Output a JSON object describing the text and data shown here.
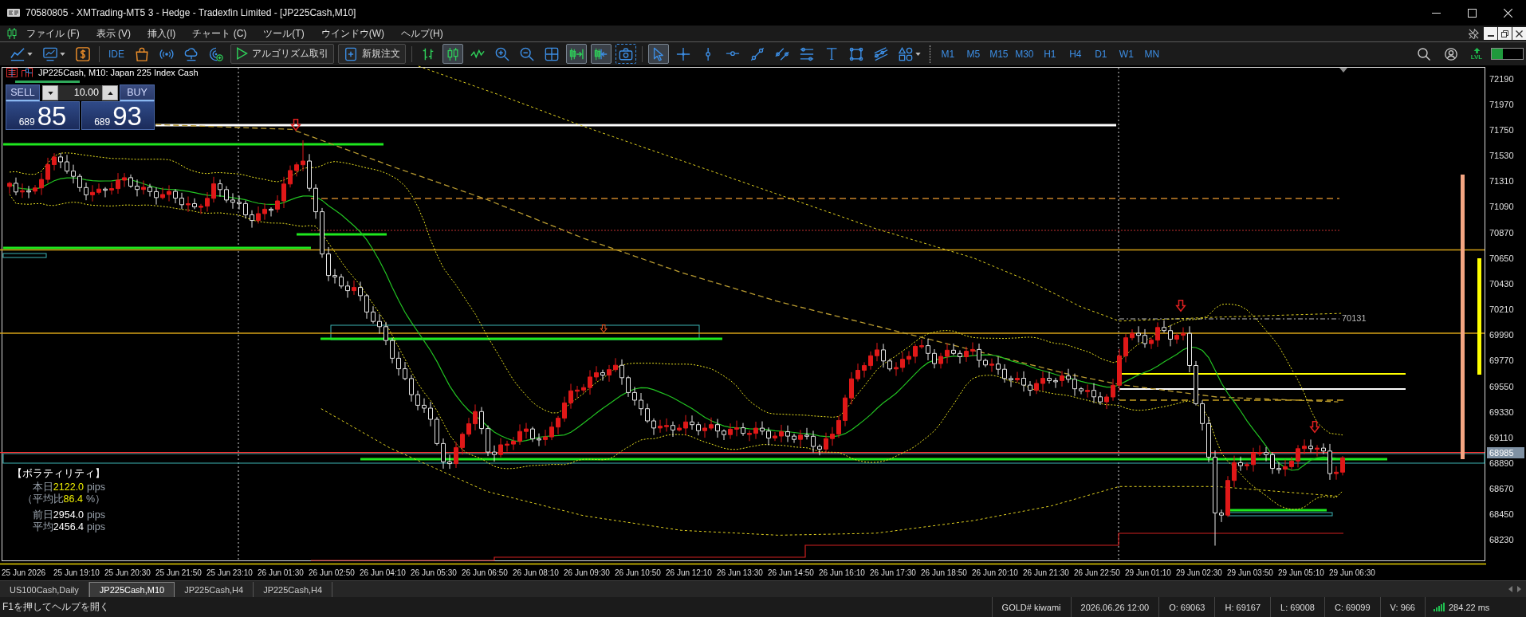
{
  "window": {
    "title": "70580805 - XMTrading-MT5 3 - Hedge - Tradexfin Limited - [JP225Cash,M10]"
  },
  "menu": {
    "items": [
      "ファイル (F)",
      "表示 (V)",
      "挿入(I)",
      "チャート (C)",
      "ツール(T)",
      "ウインドウ(W)",
      "ヘルプ(H)"
    ]
  },
  "toolbar": {
    "groups": [
      [
        {
          "kind": "chart_type",
          "selected": false
        },
        {
          "kind": "template",
          "selected": false
        },
        {
          "kind": "dollar",
          "selected": false
        }
      ],
      [
        {
          "kind": "ide",
          "label": "IDE",
          "selected": false
        },
        {
          "kind": "market",
          "selected": false
        },
        {
          "kind": "signals",
          "selected": false
        },
        {
          "kind": "cloud",
          "selected": false
        },
        {
          "kind": "vps",
          "selected": false
        },
        {
          "kind": "algo",
          "label": "アルゴリズム取引",
          "selected": false
        },
        {
          "kind": "new_order",
          "label": "新規注文",
          "selected": false
        }
      ],
      [
        {
          "kind": "bars",
          "selected": false
        },
        {
          "kind": "candles",
          "selected": true
        },
        {
          "kind": "line",
          "selected": false
        },
        {
          "kind": "zoom_in",
          "selected": false
        },
        {
          "kind": "zoom_out",
          "selected": false
        },
        {
          "kind": "grid",
          "selected": false
        },
        {
          "kind": "autoscroll",
          "selected": true
        },
        {
          "kind": "shift",
          "selected": true
        },
        {
          "kind": "screenshot",
          "selected": false
        }
      ],
      [
        {
          "kind": "cursor",
          "selected": true
        },
        {
          "kind": "crosshair",
          "selected": false
        },
        {
          "kind": "vline",
          "selected": false
        },
        {
          "kind": "hline",
          "selected": false
        },
        {
          "kind": "trendline",
          "selected": false
        },
        {
          "kind": "channel",
          "selected": false
        },
        {
          "kind": "fibo",
          "selected": false
        },
        {
          "kind": "text",
          "selected": false
        },
        {
          "kind": "rectangle",
          "selected": false
        },
        {
          "kind": "pitchfork",
          "selected": false
        },
        {
          "kind": "shapes",
          "selected": false
        }
      ]
    ],
    "timeframes": [
      {
        "label": "M1",
        "selected": false
      },
      {
        "label": "M5",
        "selected": false
      },
      {
        "label": "M15",
        "selected": false
      },
      {
        "label": "M30",
        "selected": false
      },
      {
        "label": "H1",
        "selected": false
      },
      {
        "label": "H4",
        "selected": false
      },
      {
        "label": "D1",
        "selected": false
      },
      {
        "label": "W1",
        "selected": false
      },
      {
        "label": "MN",
        "selected": false
      }
    ],
    "level_label": "LVL",
    "meter": {
      "level": 0.35
    }
  },
  "trade_panel": {
    "title": "JP225Cash, M10: Japan 225 Index Cash",
    "sell_label": "SELL",
    "buy_label": "BUY",
    "volume": "10.00",
    "sell_price": {
      "prefix": "689",
      "main": "85"
    },
    "buy_price": {
      "prefix": "689",
      "main": "93"
    }
  },
  "chart": {
    "line_label": "70131"
  },
  "volatility": {
    "title": "【ボラティリティ】",
    "rows": [
      {
        "label": "本日",
        "value": "2122.0",
        "unit": "pips",
        "color": "#f0f000"
      },
      {
        "label": "（平均比",
        "value": "86.4",
        "unit": "%）",
        "color": "#f0f000"
      },
      {
        "label": "前日",
        "value": "2954.0",
        "unit": "pips",
        "color": "#ffffff"
      },
      {
        "label": "平均",
        "value": "2456.4",
        "unit": "pips",
        "color": "#ffffff"
      }
    ]
  },
  "price_axis": {
    "ticks": [
      "72190",
      "71970",
      "71750",
      "71530",
      "71310",
      "71090",
      "70870",
      "70650",
      "70430",
      "70210",
      "69990",
      "69770",
      "69550",
      "69330",
      "69110",
      "68890",
      "68670",
      "68450",
      "68230"
    ],
    "current_price": "68985"
  },
  "time_axis": {
    "ticks": [
      "25 Jun 2026",
      "25 Jun 19:10",
      "25 Jun 20:30",
      "25 Jun 21:50",
      "25 Jun 23:10",
      "26 Jun 01:30",
      "26 Jun 02:50",
      "26 Jun 04:10",
      "26 Jun 05:30",
      "26 Jun 06:50",
      "26 Jun 08:10",
      "26 Jun 09:30",
      "26 Jun 10:50",
      "26 Jun 12:10",
      "26 Jun 13:30",
      "26 Jun 14:50",
      "26 Jun 16:10",
      "26 Jun 17:30",
      "26 Jun 18:50",
      "26 Jun 20:10",
      "26 Jun 21:30",
      "26 Jun 22:50",
      "29 Jun 01:10",
      "29 Jun 02:30",
      "29 Jun 03:50",
      "29 Jun 05:10",
      "29 Jun 06:30"
    ]
  },
  "tabs": [
    {
      "label": "US100Cash,Daily",
      "selected": false
    },
    {
      "label": "JP225Cash,M10",
      "selected": true
    },
    {
      "label": "JP225Cash,H4",
      "selected": false
    },
    {
      "label": "JP225Cash,H4",
      "selected": false
    }
  ],
  "status_bar": {
    "help": "F1を押してヘルプを開く",
    "items": [
      "GOLD# kiwami",
      "2026.06.26 12:00",
      "O: 69063",
      "H: 69167",
      "L: 69008",
      "C: 69099",
      "V: 966"
    ],
    "ping": "284.22 ms"
  }
}
